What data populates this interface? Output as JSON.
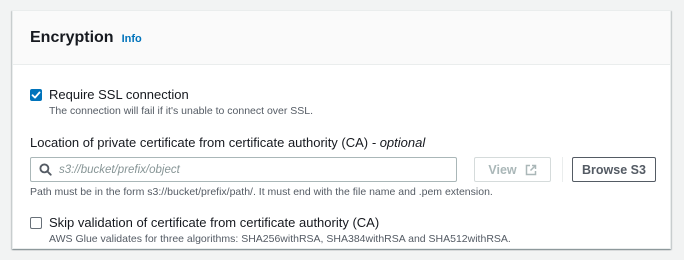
{
  "panel": {
    "title": "Encryption",
    "info_link": "Info"
  },
  "ssl": {
    "label": "Require SSL connection",
    "description": "The connection will fail if it's unable to connect over SSL.",
    "checked": true
  },
  "certificate": {
    "label": "Location of private certificate from certificate authority (CA)",
    "optional": " - optional",
    "placeholder": "s3://bucket/prefix/object",
    "value": "",
    "view_button": "View",
    "browse_button": "Browse S3",
    "constraint": "Path must be in the form s3://bucket/prefix/path/. It must end with the file name and .pem extension."
  },
  "skip_validation": {
    "label": "Skip validation of certificate from certificate authority (CA)",
    "description": "AWS Glue validates for three algorithms: SHA256withRSA, SHA384withRSA and SHA512withRSA.",
    "checked": false
  },
  "colors": {
    "accent": "#0073bb",
    "text": "#16191f",
    "secondary_text": "#545b64",
    "disabled": "#aab7b8"
  },
  "icons": {
    "search": "search-icon",
    "external": "external-link-icon",
    "check": "check-icon"
  }
}
